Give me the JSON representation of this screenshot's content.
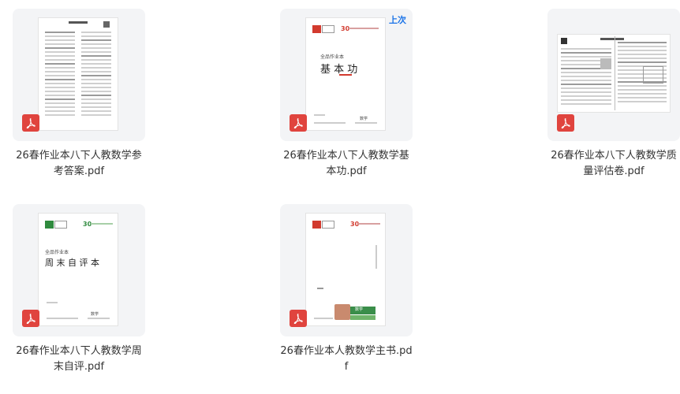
{
  "files": [
    {
      "name": "26春作业本八下人教数学参考答案.pdf",
      "badge": "",
      "icon": "pdf-icon"
    },
    {
      "name": "26春作业本八下人教数学基本功.pdf",
      "badge": "上次",
      "icon": "pdf-icon",
      "cover": {
        "series": "全品作业本",
        "title": "基 本 功",
        "subject": "数学"
      }
    },
    {
      "name": "26春作业本八下人教数学质量评估卷.pdf",
      "badge": "",
      "icon": "pdf-icon"
    },
    {
      "name": "26春作业本八下人教数学周末自评.pdf",
      "badge": "",
      "icon": "pdf-icon",
      "cover": {
        "series": "全品作业本",
        "title": "周 末 自 评 本",
        "subject": "数学"
      }
    },
    {
      "name": "26春作业本人教数学主书.pdf",
      "badge": "",
      "icon": "pdf-icon",
      "cover": {
        "subject": "数学"
      }
    }
  ],
  "colors": {
    "pdf_red": "#e0443e",
    "card_bg": "#f3f4f6",
    "recent_blue": "#1a73e8"
  }
}
